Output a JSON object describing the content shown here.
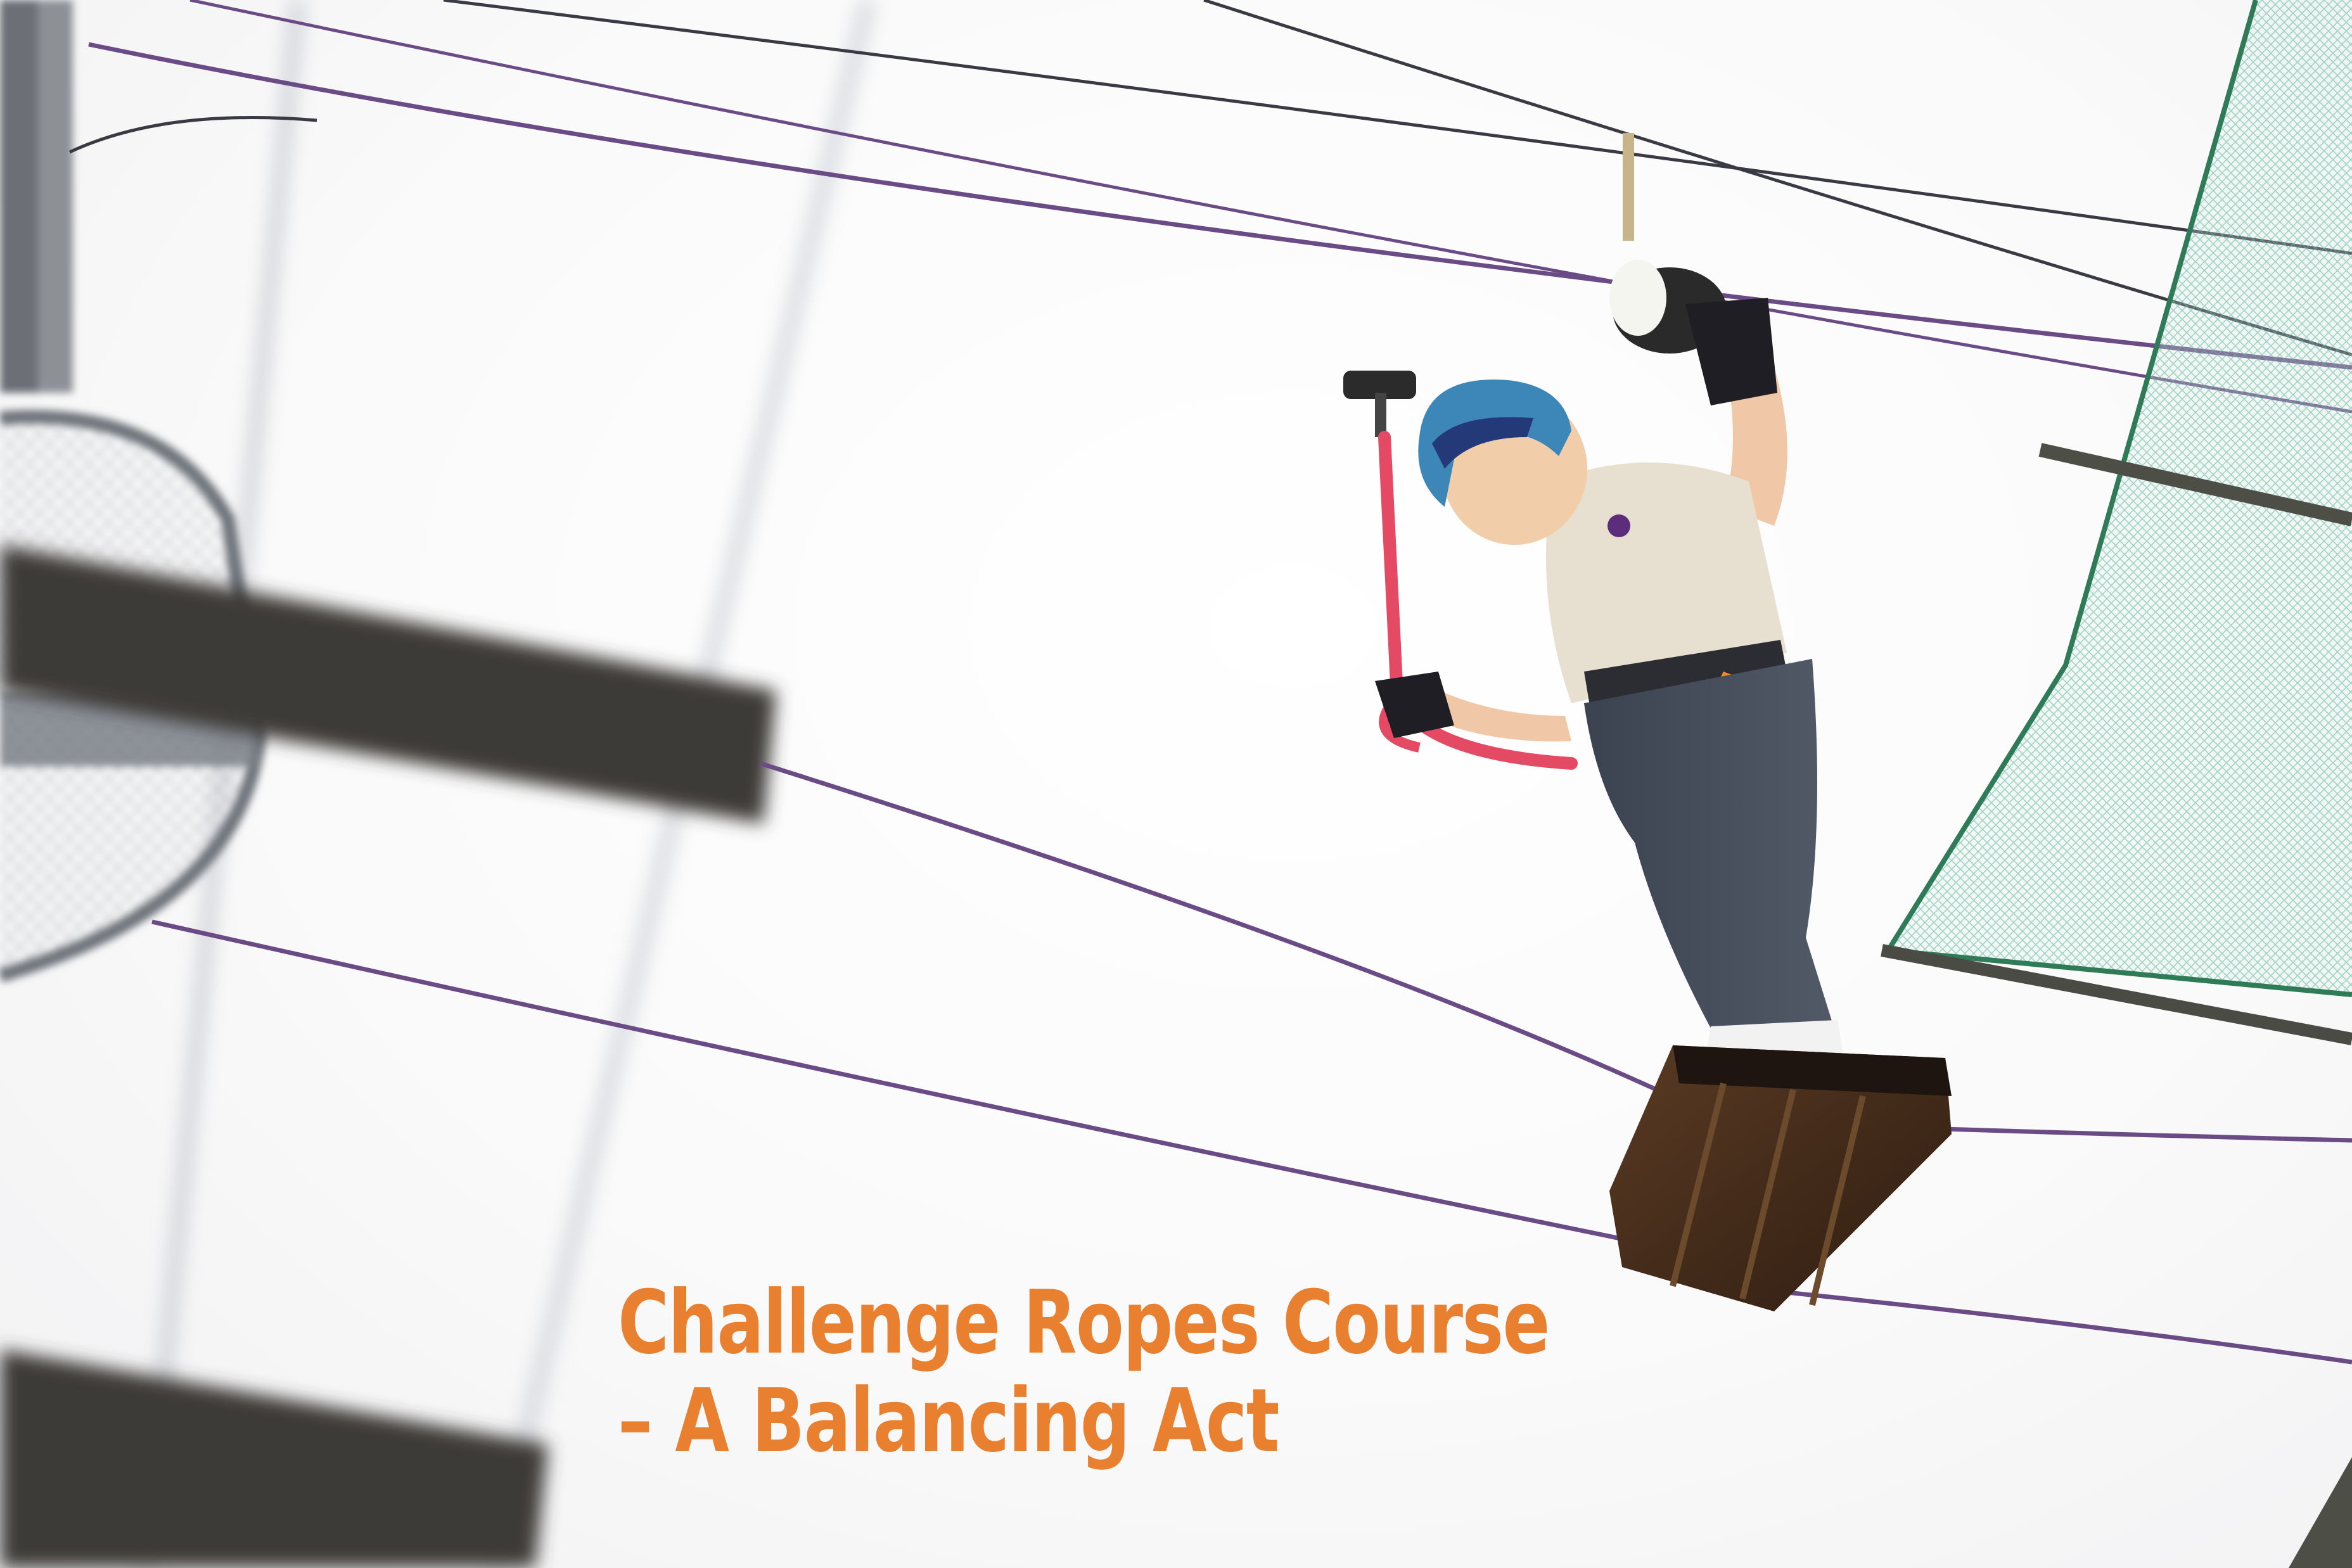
{
  "photo": {
    "subject": "child-on-ropes-course-balance-platform",
    "caption_color": "#e8802f"
  },
  "caption": {
    "line1": "Challenge Ropes Course",
    "line2": "– A Balancing Act"
  }
}
